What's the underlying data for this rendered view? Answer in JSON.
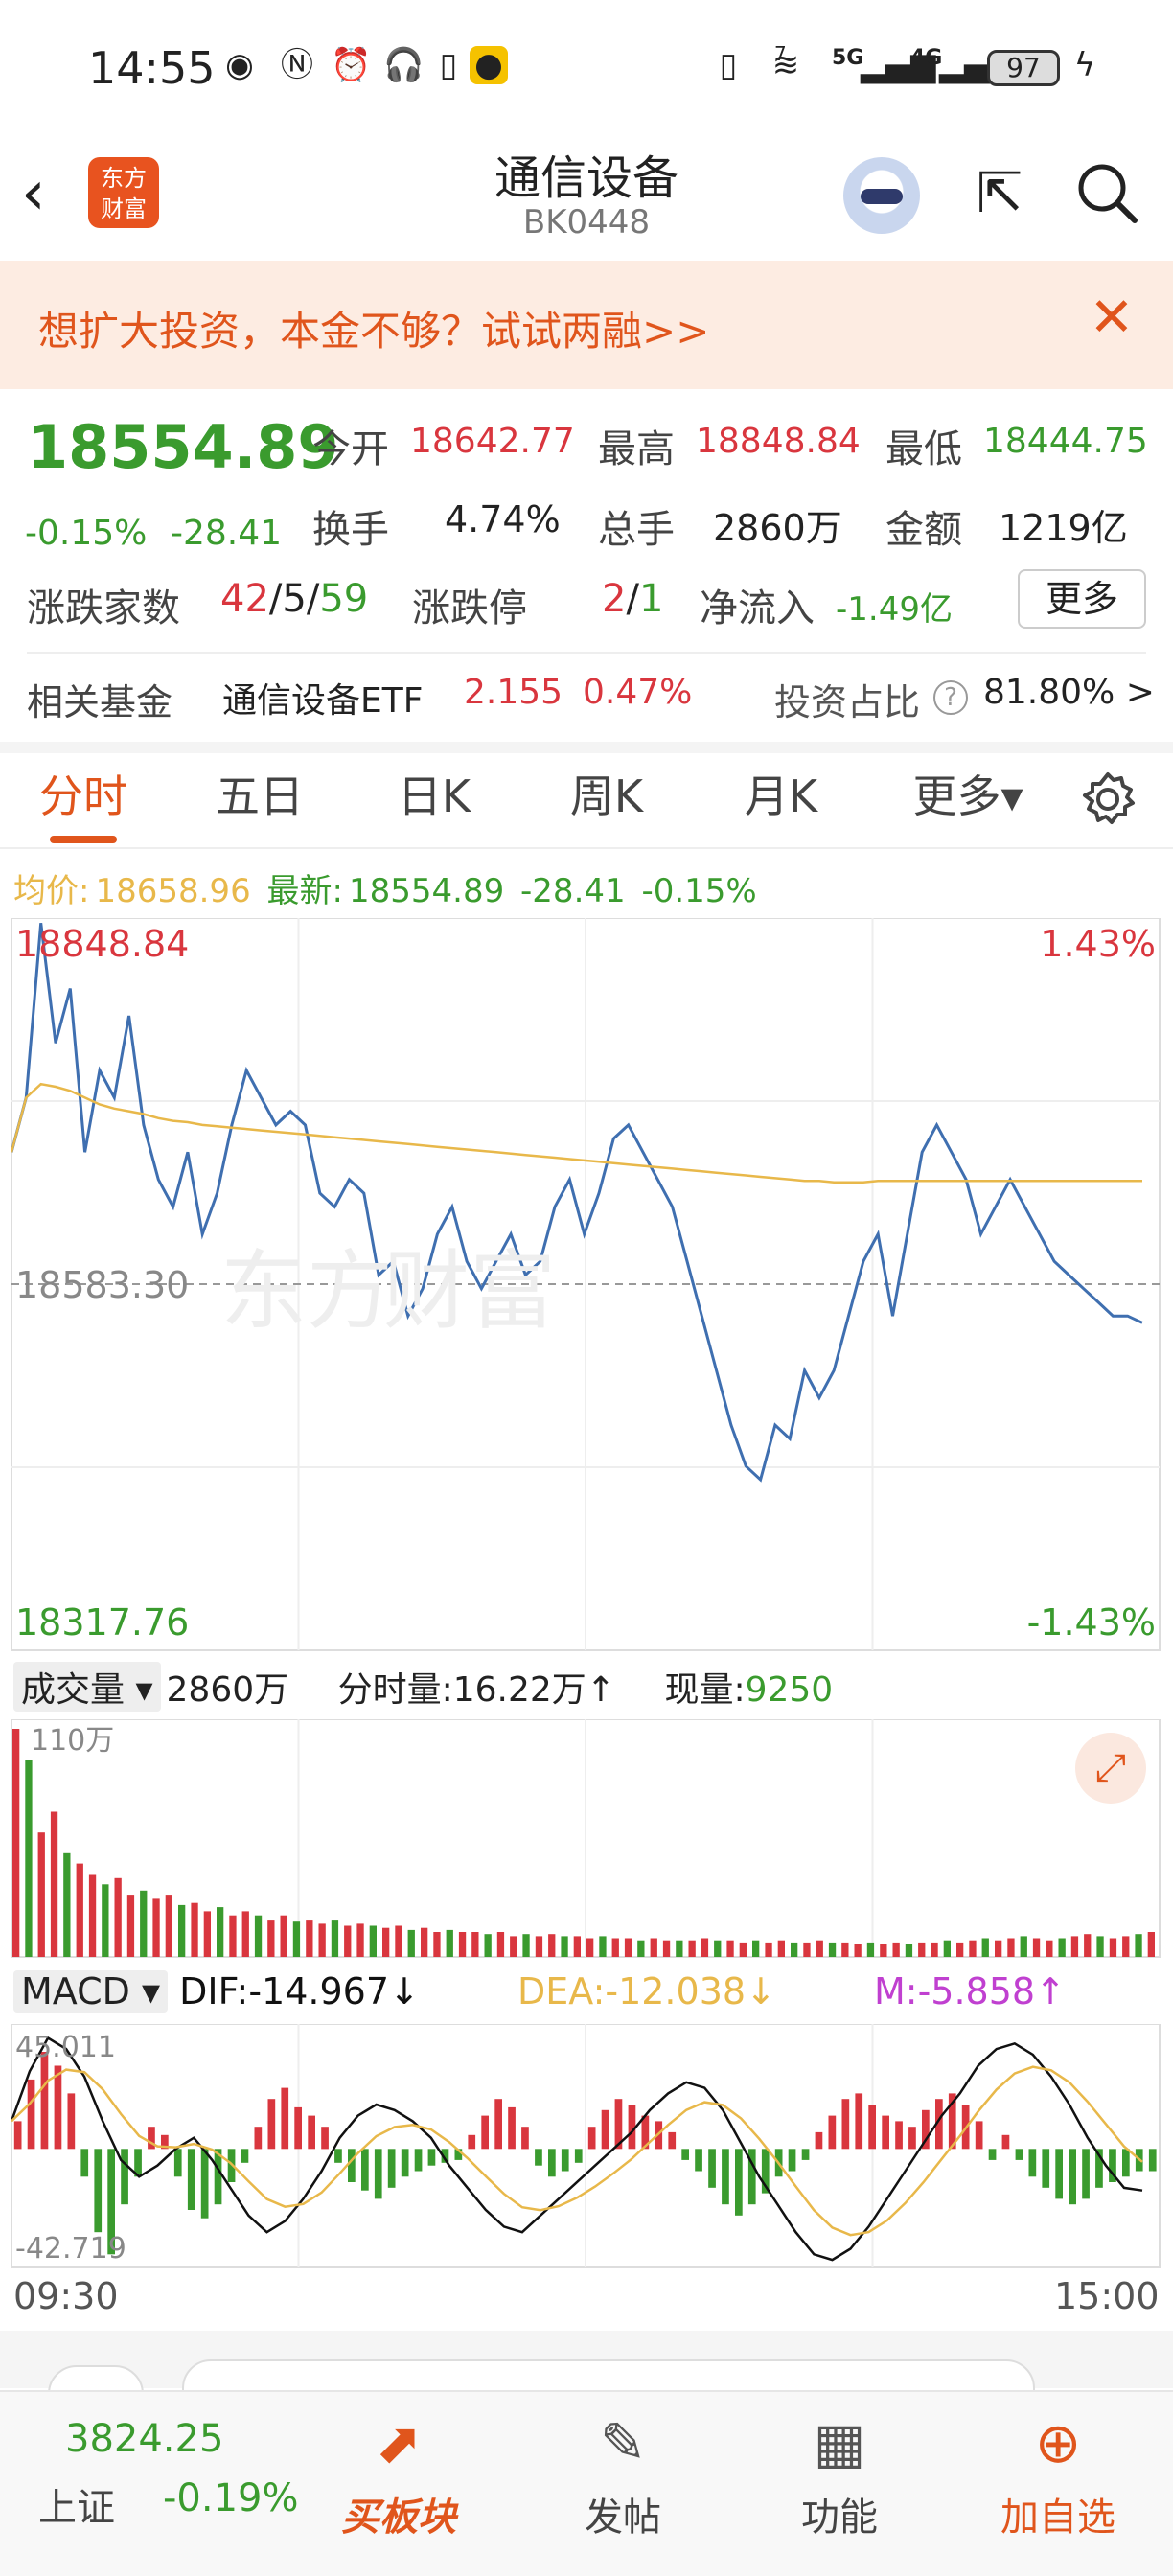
{
  "status_bar": {
    "time": "14:55",
    "network_5g": "5G",
    "network_4g": "4G",
    "superscript": "7",
    "battery": "97",
    "icons": [
      "eye-icon",
      "nfc-icon",
      "alarm-icon",
      "headphone-icon",
      "battery-small-icon",
      "weibo-icon",
      "vibrate-icon",
      "wifi-icon",
      "signal-icon",
      "charging-icon"
    ]
  },
  "header": {
    "logo_line1": "东方",
    "logo_line2": "财富",
    "title": "通信设备",
    "code": "BK0448"
  },
  "banner": {
    "text": "想扩大投资，本金不够？试试两融>>"
  },
  "quote": {
    "price": "18554.89",
    "change_pct": "-0.15%",
    "change_pts": "-28.41",
    "open_label": "今开",
    "open": "18642.77",
    "high_label": "最高",
    "high": "18848.84",
    "low_label": "最低",
    "low": "18444.75",
    "turnover_label": "换手",
    "turnover": "4.74%",
    "volume_label": "总手",
    "volume": "2860万",
    "amount_label": "金额",
    "amount": "1219亿",
    "breadth_label": "涨跌家数",
    "breadth_up": "42",
    "breadth_flat": "5",
    "breadth_down": "59",
    "limit_label": "涨跌停",
    "limit_up": "2",
    "limit_down": "1",
    "inflow_label": "净流入",
    "inflow": "-1.49亿",
    "more": "更多",
    "fund_label": "相关基金",
    "fund_name": "通信设备ETF",
    "fund_price": "2.155",
    "fund_change": "0.47%",
    "ratio_label": "投资占比",
    "ratio_value": "81.80% >"
  },
  "tabs": [
    {
      "label": "分时",
      "active": true
    },
    {
      "label": "五日"
    },
    {
      "label": "日K"
    },
    {
      "label": "周K"
    },
    {
      "label": "月K"
    },
    {
      "label": "更多▾"
    }
  ],
  "info_line": {
    "avg_label": "均价:",
    "avg_value": "18658.96",
    "latest_label": "最新:",
    "latest_value": "18554.89",
    "latest_change": "-28.41",
    "latest_pct": "-0.15%"
  },
  "colors": {
    "up": "#d9363e",
    "down": "#3a9b2e",
    "price_line": "#3f6fb0",
    "avg_line": "#e8b84a",
    "accent": "#e0551c",
    "dif": "#111111",
    "dea": "#e8b84a",
    "m": "#c040d0"
  },
  "chart_data": [
    {
      "type": "line",
      "y_top_label": "18848.84",
      "y_mid_label": "18583.30",
      "y_bottom_label": "18317.76",
      "pct_top_label": "1.43%",
      "pct_bottom_label": "-1.43%",
      "ylim": [
        18317.76,
        18848.84
      ],
      "prev_close": 18583.3,
      "x_start": "09:30",
      "x_end": "15:00",
      "series": [
        {
          "values": [
            18680,
            18720,
            18848,
            18760,
            18800,
            18680,
            18740,
            18720,
            18780,
            18700,
            18660,
            18640,
            18680,
            18620,
            18650,
            18700,
            18740,
            18720,
            18700,
            18710,
            18700,
            18650,
            18640,
            18660,
            18650,
            18590,
            18600,
            18560,
            18580,
            18620,
            18640,
            18600,
            18580,
            18600,
            18620,
            18590,
            18600,
            18640,
            18660,
            18620,
            18650,
            18690,
            18700,
            18680,
            18660,
            18640,
            18600,
            18560,
            18520,
            18480,
            18450,
            18440,
            18480,
            18470,
            18520,
            18500,
            18520,
            18560,
            18600,
            18620,
            18560,
            18620,
            18680,
            18700,
            18680,
            18660,
            18620,
            18640,
            18660,
            18640,
            18620,
            18600,
            18590,
            18580,
            18570,
            18560,
            18560,
            18555
          ]
        },
        {
          "values": [
            18680,
            18720,
            18730,
            18728,
            18725,
            18720,
            18715,
            18712,
            18710,
            18708,
            18705,
            18703,
            18702,
            18700,
            18699,
            18698,
            18697,
            18696,
            18695,
            18694,
            18693,
            18692,
            18691,
            18690,
            18689,
            18688,
            18687,
            18686,
            18685,
            18684,
            18683,
            18682,
            18681,
            18680,
            18679,
            18678,
            18677,
            18676,
            18675,
            18674,
            18673,
            18672,
            18671,
            18670,
            18669,
            18668,
            18667,
            18666,
            18665,
            18664,
            18663,
            18662,
            18661,
            18660,
            18659,
            18659,
            18658,
            18658,
            18658,
            18659,
            18659,
            18659,
            18659,
            18659,
            18659,
            18659,
            18659,
            18659,
            18659,
            18659,
            18659,
            18659,
            18659,
            18659,
            18659,
            18659,
            18659,
            18659
          ]
        }
      ]
    },
    {
      "type": "bar",
      "title": "成交量",
      "total": "2860万",
      "period_label": "分时量:",
      "period_value": "16.22万",
      "period_arrow": "↑",
      "current_label": "现量:",
      "current_value": "9250",
      "ylim_label": "110万",
      "values": [
        110,
        95,
        60,
        70,
        50,
        45,
        40,
        35,
        38,
        30,
        32,
        28,
        30,
        25,
        26,
        22,
        24,
        20,
        22,
        20,
        18,
        20,
        17,
        18,
        16,
        18,
        15,
        16,
        15,
        14,
        15,
        13,
        14,
        12,
        13,
        12,
        12,
        11,
        12,
        10,
        11,
        10,
        11,
        10,
        10,
        9,
        10,
        9,
        9,
        8,
        9,
        8,
        8,
        8,
        9,
        8,
        8,
        7,
        8,
        7,
        8,
        7,
        7,
        8,
        7,
        7,
        6,
        7,
        6,
        7,
        6,
        7,
        7,
        8,
        7,
        8,
        9,
        8,
        9,
        10,
        9,
        8,
        9,
        10,
        11,
        10,
        9,
        10,
        11,
        12
      ]
    },
    {
      "type": "bar",
      "title": "MACD",
      "dif_label": "DIF:-14.967",
      "dif_arrow": "↓",
      "dea_label": "DEA:-12.038",
      "dea_arrow": "↓",
      "m_label": "M:-5.858",
      "m_arrow": "↑",
      "ylim": [
        -42.719,
        45.011
      ],
      "y_top_label": "45.011",
      "y_bottom_label": "-42.719",
      "hist": [
        10,
        25,
        35,
        30,
        20,
        -10,
        -30,
        -38,
        -20,
        -10,
        8,
        5,
        -10,
        -22,
        -25,
        -20,
        -12,
        -5,
        8,
        18,
        22,
        15,
        12,
        8,
        -5,
        -12,
        -15,
        -18,
        -14,
        -10,
        -8,
        -6,
        -5,
        -4,
        5,
        12,
        18,
        15,
        8,
        -6,
        -10,
        -8,
        -5,
        8,
        14,
        18,
        16,
        12,
        10,
        6,
        -4,
        -8,
        -14,
        -20,
        -24,
        -20,
        -16,
        -10,
        -8,
        -4,
        6,
        12,
        18,
        20,
        16,
        12,
        10,
        8,
        14,
        18,
        20,
        16,
        10,
        -4,
        5,
        -4,
        -10,
        -14,
        -18,
        -20,
        -18,
        -14,
        -12,
        -10,
        -8,
        -8
      ],
      "dif": [
        10,
        28,
        40,
        36,
        26,
        10,
        -4,
        -10,
        -6,
        0,
        4,
        -4,
        -14,
        -24,
        -30,
        -26,
        -18,
        -8,
        4,
        12,
        16,
        14,
        10,
        4,
        -6,
        -14,
        -22,
        -28,
        -30,
        -24,
        -18,
        -12,
        -6,
        0,
        6,
        14,
        20,
        24,
        22,
        14,
        2,
        -10,
        -20,
        -30,
        -38,
        -40,
        -36,
        -28,
        -18,
        -8,
        2,
        12,
        20,
        30,
        36,
        38,
        34,
        26,
        16,
        4,
        -6,
        -14,
        -15
      ]
    }
  ],
  "bottom_bar": {
    "index_value": "3824.25",
    "index_name": "上证",
    "index_change": "-0.19%",
    "buy_label": "买板块",
    "post_label": "发帖",
    "func_label": "功能",
    "watch_label": "加自选"
  }
}
